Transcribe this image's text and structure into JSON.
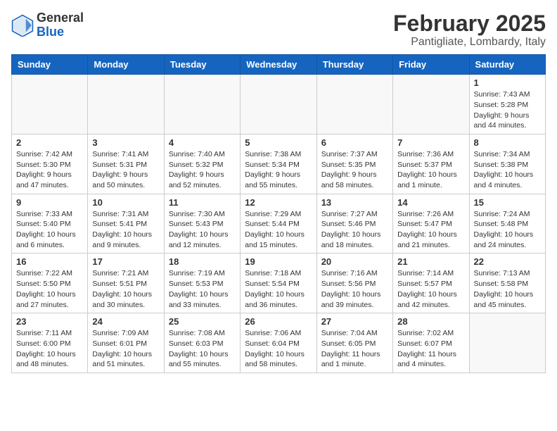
{
  "logo": {
    "general": "General",
    "blue": "Blue"
  },
  "header": {
    "title": "February 2025",
    "subtitle": "Pantigliate, Lombardy, Italy"
  },
  "days_of_week": [
    "Sunday",
    "Monday",
    "Tuesday",
    "Wednesday",
    "Thursday",
    "Friday",
    "Saturday"
  ],
  "weeks": [
    [
      {
        "day": "",
        "info": ""
      },
      {
        "day": "",
        "info": ""
      },
      {
        "day": "",
        "info": ""
      },
      {
        "day": "",
        "info": ""
      },
      {
        "day": "",
        "info": ""
      },
      {
        "day": "",
        "info": ""
      },
      {
        "day": "1",
        "info": "Sunrise: 7:43 AM\nSunset: 5:28 PM\nDaylight: 9 hours and 44 minutes."
      }
    ],
    [
      {
        "day": "2",
        "info": "Sunrise: 7:42 AM\nSunset: 5:30 PM\nDaylight: 9 hours and 47 minutes."
      },
      {
        "day": "3",
        "info": "Sunrise: 7:41 AM\nSunset: 5:31 PM\nDaylight: 9 hours and 50 minutes."
      },
      {
        "day": "4",
        "info": "Sunrise: 7:40 AM\nSunset: 5:32 PM\nDaylight: 9 hours and 52 minutes."
      },
      {
        "day": "5",
        "info": "Sunrise: 7:38 AM\nSunset: 5:34 PM\nDaylight: 9 hours and 55 minutes."
      },
      {
        "day": "6",
        "info": "Sunrise: 7:37 AM\nSunset: 5:35 PM\nDaylight: 9 hours and 58 minutes."
      },
      {
        "day": "7",
        "info": "Sunrise: 7:36 AM\nSunset: 5:37 PM\nDaylight: 10 hours and 1 minute."
      },
      {
        "day": "8",
        "info": "Sunrise: 7:34 AM\nSunset: 5:38 PM\nDaylight: 10 hours and 4 minutes."
      }
    ],
    [
      {
        "day": "9",
        "info": "Sunrise: 7:33 AM\nSunset: 5:40 PM\nDaylight: 10 hours and 6 minutes."
      },
      {
        "day": "10",
        "info": "Sunrise: 7:31 AM\nSunset: 5:41 PM\nDaylight: 10 hours and 9 minutes."
      },
      {
        "day": "11",
        "info": "Sunrise: 7:30 AM\nSunset: 5:43 PM\nDaylight: 10 hours and 12 minutes."
      },
      {
        "day": "12",
        "info": "Sunrise: 7:29 AM\nSunset: 5:44 PM\nDaylight: 10 hours and 15 minutes."
      },
      {
        "day": "13",
        "info": "Sunrise: 7:27 AM\nSunset: 5:46 PM\nDaylight: 10 hours and 18 minutes."
      },
      {
        "day": "14",
        "info": "Sunrise: 7:26 AM\nSunset: 5:47 PM\nDaylight: 10 hours and 21 minutes."
      },
      {
        "day": "15",
        "info": "Sunrise: 7:24 AM\nSunset: 5:48 PM\nDaylight: 10 hours and 24 minutes."
      }
    ],
    [
      {
        "day": "16",
        "info": "Sunrise: 7:22 AM\nSunset: 5:50 PM\nDaylight: 10 hours and 27 minutes."
      },
      {
        "day": "17",
        "info": "Sunrise: 7:21 AM\nSunset: 5:51 PM\nDaylight: 10 hours and 30 minutes."
      },
      {
        "day": "18",
        "info": "Sunrise: 7:19 AM\nSunset: 5:53 PM\nDaylight: 10 hours and 33 minutes."
      },
      {
        "day": "19",
        "info": "Sunrise: 7:18 AM\nSunset: 5:54 PM\nDaylight: 10 hours and 36 minutes."
      },
      {
        "day": "20",
        "info": "Sunrise: 7:16 AM\nSunset: 5:56 PM\nDaylight: 10 hours and 39 minutes."
      },
      {
        "day": "21",
        "info": "Sunrise: 7:14 AM\nSunset: 5:57 PM\nDaylight: 10 hours and 42 minutes."
      },
      {
        "day": "22",
        "info": "Sunrise: 7:13 AM\nSunset: 5:58 PM\nDaylight: 10 hours and 45 minutes."
      }
    ],
    [
      {
        "day": "23",
        "info": "Sunrise: 7:11 AM\nSunset: 6:00 PM\nDaylight: 10 hours and 48 minutes."
      },
      {
        "day": "24",
        "info": "Sunrise: 7:09 AM\nSunset: 6:01 PM\nDaylight: 10 hours and 51 minutes."
      },
      {
        "day": "25",
        "info": "Sunrise: 7:08 AM\nSunset: 6:03 PM\nDaylight: 10 hours and 55 minutes."
      },
      {
        "day": "26",
        "info": "Sunrise: 7:06 AM\nSunset: 6:04 PM\nDaylight: 10 hours and 58 minutes."
      },
      {
        "day": "27",
        "info": "Sunrise: 7:04 AM\nSunset: 6:05 PM\nDaylight: 11 hours and 1 minute."
      },
      {
        "day": "28",
        "info": "Sunrise: 7:02 AM\nSunset: 6:07 PM\nDaylight: 11 hours and 4 minutes."
      },
      {
        "day": "",
        "info": ""
      }
    ]
  ]
}
